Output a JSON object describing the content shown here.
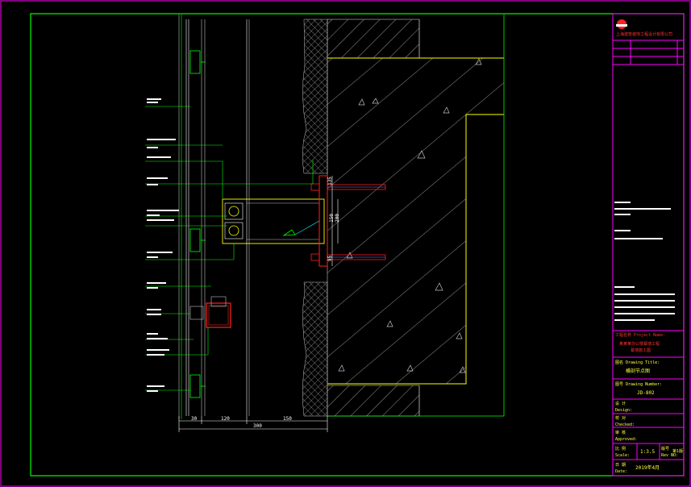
{
  "dimensions": {
    "left_30": "30",
    "mid_120": "120",
    "right_150": "150",
    "total_300": "300",
    "v_135": "135",
    "v_150": "150",
    "v_200": "200",
    "v_95": "95"
  },
  "title_block": {
    "company": "上海建筑装饰工程设计有限公司",
    "project_label": "工程名称 Project Name:",
    "project_name_line1": "某某某办公楼幕墙工程",
    "project_name_line2": "幕墙施工图",
    "drawing_title_label": "图名 Drawing Title:",
    "drawing_title": "横剖节点图",
    "drawing_number_label": "图号 Drawing Number:",
    "drawing_number": "JD-802",
    "design_label": "设 计",
    "design_en": "Design:",
    "checked_label": "校 对",
    "checked_en": "Checked:",
    "approved_label": "审 核",
    "approved_en": "Approved:",
    "scale_label": "比 例",
    "scale_en": "Scale:",
    "scale_value": "1:3.5",
    "revision_label": "版号",
    "revision_en": "Rev NO:",
    "revision_value": "第1版",
    "date_label": "日 期",
    "date_en": "Date:",
    "date_value": "2019年4月"
  },
  "colors": {
    "frame": "#00ff00",
    "title_block_border": "#ff00ff",
    "red": "#ff2020",
    "yellow": "#ffff00",
    "white": "#ffffff",
    "cyan": "#00ffff",
    "gray": "#c0c0c0"
  }
}
